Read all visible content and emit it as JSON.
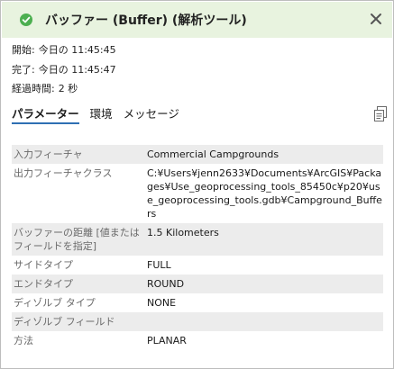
{
  "header": {
    "title": "バッファー (Buffer) (解析ツール)",
    "status_icon": "check-circle-icon",
    "status_color": "#4caf50",
    "close_icon": "close-icon"
  },
  "meta": {
    "start": {
      "label": "開始:",
      "value": "今日の 11:45:45"
    },
    "end": {
      "label": "完了:",
      "value": "今日の 11:45:47"
    },
    "elapsed": {
      "label": "経過時間:",
      "value": "2 秒"
    }
  },
  "tabs": [
    {
      "label": "パラメーター",
      "active": true
    },
    {
      "label": "環境",
      "active": false
    },
    {
      "label": "メッセージ",
      "active": false
    }
  ],
  "accent_color": "#2f6fb3",
  "parameters": [
    {
      "name": "入力フィーチャ",
      "value": "Commercial Campgrounds"
    },
    {
      "name": "出力フィーチャクラス",
      "value": "C:¥Users¥jenn2633¥Documents¥ArcGIS¥Packages¥Use_geoprocessing_tools_85450c¥p20¥use_geoprocessing_tools.gdb¥Campground_Buffers"
    },
    {
      "name": "バッファーの距離 [値または フィールドを指定]",
      "value": "1.5 Kilometers"
    },
    {
      "name": "サイドタイプ",
      "value": "FULL"
    },
    {
      "name": "エンドタイプ",
      "value": "ROUND"
    },
    {
      "name": "ディゾルブ タイプ",
      "value": "NONE"
    },
    {
      "name": "ディゾルブ フィールド",
      "value": ""
    },
    {
      "name": "方法",
      "value": "PLANAR"
    }
  ]
}
